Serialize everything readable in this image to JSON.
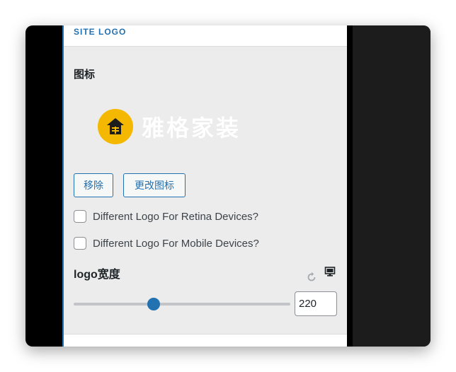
{
  "section": {
    "title": "SITE LOGO"
  },
  "icon_field": {
    "label": "图标",
    "logo_text": "雅格家装",
    "brand_color": "#f5b800",
    "remove_label": "移除",
    "change_label": "更改图标"
  },
  "options": {
    "retina_label": "Different Logo For Retina Devices?",
    "retina_checked": false,
    "mobile_label": "Different Logo For Mobile Devices?",
    "mobile_checked": false
  },
  "logo_width": {
    "label": "logo宽度",
    "value": "220",
    "slider_fraction": 0.37,
    "reset_icon": "reset-icon",
    "device_icon": "desktop-icon"
  },
  "colors": {
    "accent": "#2271b1"
  }
}
